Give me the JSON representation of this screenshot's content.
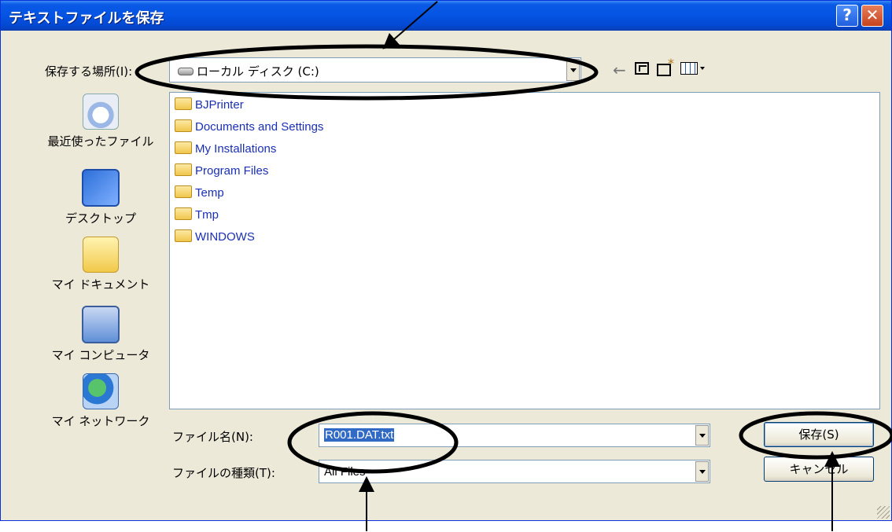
{
  "window": {
    "title": "テキストファイルを保存",
    "help_glyph": "?",
    "close_glyph": "✕"
  },
  "look_in": {
    "label": "保存する場所(I):",
    "value": "ローカル ディスク (C:)"
  },
  "toolbar": {
    "back_glyph": "←"
  },
  "places": [
    {
      "label": "最近使ったファイル",
      "icon": "recent-icon"
    },
    {
      "label": "デスクトップ",
      "icon": "desktop-icon"
    },
    {
      "label": "マイ ドキュメント",
      "icon": "my-documents-icon"
    },
    {
      "label": "マイ コンピュータ",
      "icon": "my-computer-icon"
    },
    {
      "label": "マイ ネットワーク",
      "icon": "my-network-icon"
    }
  ],
  "files": [
    {
      "name": "BJPrinter"
    },
    {
      "name": "Documents and Settings"
    },
    {
      "name": "My Installations"
    },
    {
      "name": "Program Files"
    },
    {
      "name": "Temp"
    },
    {
      "name": "Tmp"
    },
    {
      "name": "WINDOWS"
    }
  ],
  "file_name": {
    "label": "ファイル名(N):",
    "value": "R001.DAT.txt"
  },
  "file_type": {
    "label": "ファイルの種類(T):",
    "value": "All Files"
  },
  "buttons": {
    "save": "保存(S)",
    "cancel": "キャンセル"
  },
  "colors": {
    "titlebar": "#0554e3",
    "folder_text": "#1a2fb5",
    "selection": "#316ac5"
  }
}
